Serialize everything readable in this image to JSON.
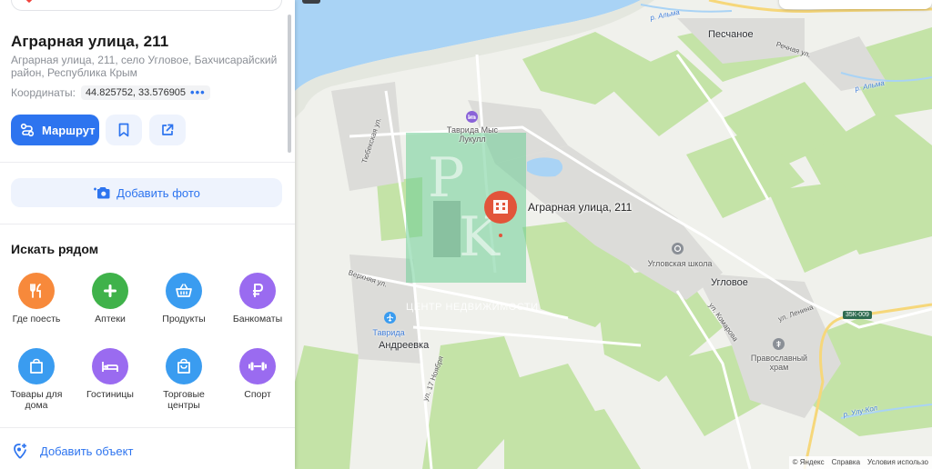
{
  "place": {
    "title": "Аграрная улица, 211",
    "address": "Аграрная улица, 211, село Угловое, Бахчисарайский район, Республика Крым",
    "coords_label": "Координаты:",
    "coords_value": "44.825752, 33.576905"
  },
  "actions": {
    "route_label": "Маршрут",
    "add_photo_label": "Добавить фото",
    "add_object_label": "Добавить объект"
  },
  "nearby": {
    "title": "Искать рядом",
    "categories": [
      {
        "label": "Где поесть",
        "icon": "fork-knife-icon",
        "color": "#f7893b"
      },
      {
        "label": "Аптеки",
        "icon": "plus-icon",
        "color": "#3fb24a"
      },
      {
        "label": "Продукты",
        "icon": "basket-icon",
        "color": "#3a9cf0"
      },
      {
        "label": "Банкоматы",
        "icon": "ruble-icon",
        "color": "#9a6bf0"
      },
      {
        "label": "Товары для дома",
        "icon": "bag-icon",
        "color": "#3a9cf0"
      },
      {
        "label": "Гостиницы",
        "icon": "bed-icon",
        "color": "#9a6bf0"
      },
      {
        "label": "Торговые центры",
        "icon": "shopping-bag-icon",
        "color": "#3a9cf0"
      },
      {
        "label": "Спорт",
        "icon": "dumbbell-icon",
        "color": "#9a6bf0"
      }
    ]
  },
  "map": {
    "pin_label": "Аграрная улица, 211",
    "labels": {
      "peschanoe": "Песчаное",
      "uglovoe": "Угловое",
      "andreevka": "Андреевка",
      "tavrida_lukull": "Таврида Мыс Лукулл",
      "tavrida": "Таврида",
      "school": "Угловская школа",
      "church": "Православный храм",
      "river_alma": "р. Альма",
      "river_alma2": "р. Альма",
      "river_ulukol": "р. Улу-Кол",
      "rechnaya": "Речная ул.",
      "tyubekskaya": "Тюбекская ул.",
      "verkhnyaya": "Верхняя ул.",
      "lenina": "ул. Ленина",
      "komarova": "ул. Комарова",
      "nov17": "ул. 17 Ноября",
      "road_badge": "35К-009",
      "watermark_text": "ЦЕНТР НЕДВИЖИМОСТИ"
    },
    "attribution": [
      "© Яндекс",
      "Справка",
      "Условия использо"
    ]
  },
  "colors": {
    "accent": "#2d74ef",
    "water": "#a9d3f5",
    "field": "#c4e3a7",
    "pin": "#e2543a"
  }
}
